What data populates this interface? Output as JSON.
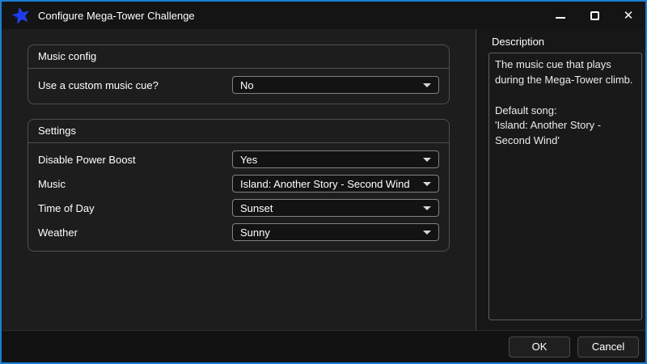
{
  "window": {
    "title": "Configure Mega-Tower Challenge",
    "controls": {
      "minimize": "minimize",
      "maximize": "maximize",
      "close": "✕"
    }
  },
  "groups": [
    {
      "title": "Music config",
      "rows": [
        {
          "label": "Use a custom music cue?",
          "value": "No"
        }
      ]
    },
    {
      "title": "Settings",
      "rows": [
        {
          "label": "Disable Power Boost",
          "value": "Yes"
        },
        {
          "label": "Music",
          "value": "Island: Another Story - Second Wind"
        },
        {
          "label": "Time of Day",
          "value": "Sunset"
        },
        {
          "label": "Weather",
          "value": "Sunny"
        }
      ]
    }
  ],
  "description_panel": {
    "title": "Description",
    "text": "The music cue that plays during the Mega-Tower climb.\n\nDefault song:\n'Island: Another Story - Second Wind'"
  },
  "footer": {
    "ok_label": "OK",
    "cancel_label": "Cancel"
  },
  "icons": {
    "app_icon": "blue-star",
    "minimize_icon": "horizontal-bar",
    "maximize_icon": "square-outline",
    "close_icon": "x-cross",
    "combo_arrow_icon": "triangle-down"
  },
  "colors": {
    "window_border_accent": "#1b80d4",
    "titlebar_bg": "#141414",
    "left_panel_bg": "#1d1d1d",
    "right_panel_bg": "#171717",
    "combo_border": "#828282",
    "icon_blue": "#1c3af0",
    "text": "#ffffff"
  }
}
